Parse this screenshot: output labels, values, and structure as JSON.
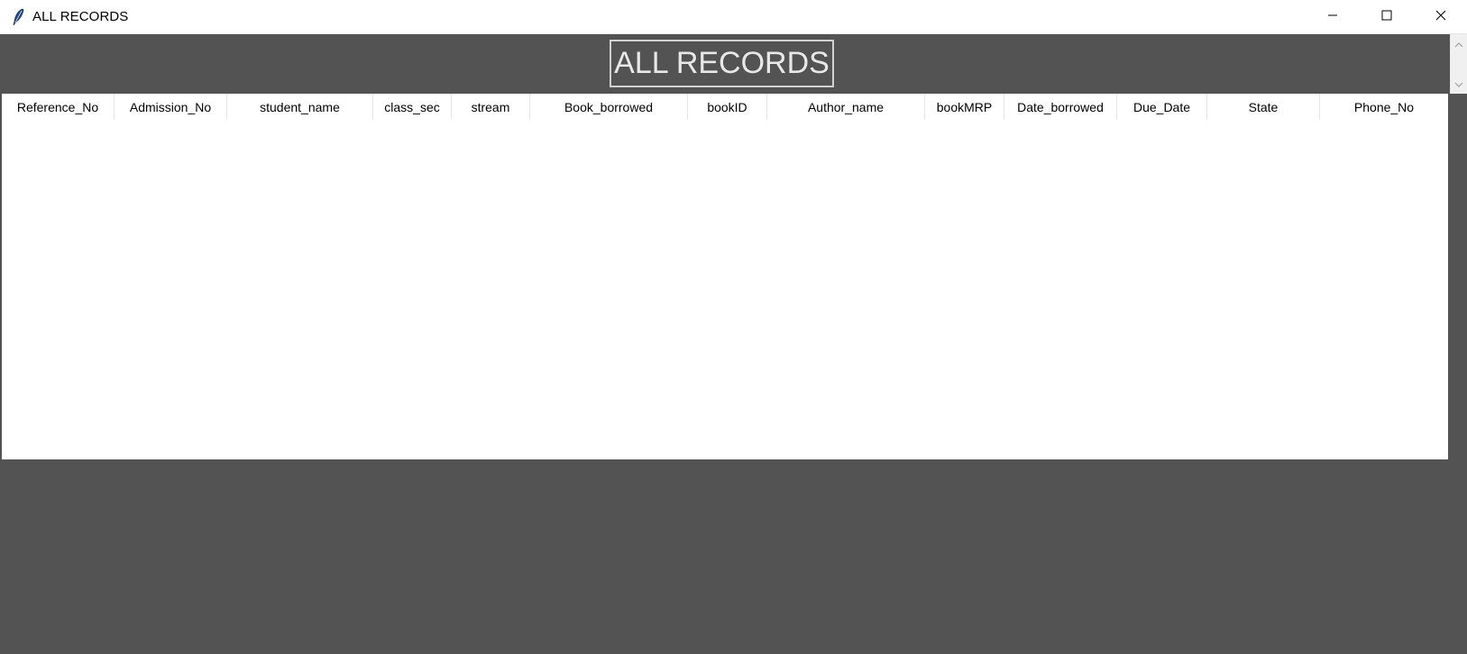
{
  "window": {
    "title": "ALL RECORDS",
    "controls": {
      "minimize": "minimize-icon",
      "maximize": "maximize-icon",
      "close": "close-icon"
    }
  },
  "main": {
    "heading": "ALL RECORDS"
  },
  "table": {
    "columns": [
      "Reference_No",
      "Admission_No",
      "student_name",
      "class_sec",
      "stream",
      "Book_borrowed",
      "bookID",
      "Author_name",
      "bookMRP",
      "Date_borrowed",
      "Due_Date",
      "State",
      "Phone_No"
    ],
    "rows": []
  },
  "colors": {
    "background": "#535353",
    "table_background": "#ffffff",
    "heading_text": "#e8e8e8",
    "heading_border": "#d0d0d0"
  }
}
